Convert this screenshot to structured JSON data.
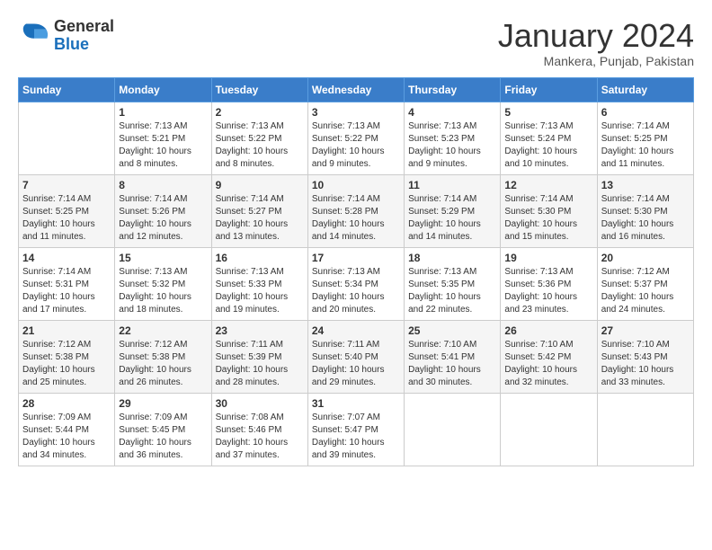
{
  "logo": {
    "general": "General",
    "blue": "Blue"
  },
  "title": "January 2024",
  "location": "Mankera, Punjab, Pakistan",
  "days_of_week": [
    "Sunday",
    "Monday",
    "Tuesday",
    "Wednesday",
    "Thursday",
    "Friday",
    "Saturday"
  ],
  "weeks": [
    [
      {
        "day": "",
        "info": ""
      },
      {
        "day": "1",
        "info": "Sunrise: 7:13 AM\nSunset: 5:21 PM\nDaylight: 10 hours\nand 8 minutes."
      },
      {
        "day": "2",
        "info": "Sunrise: 7:13 AM\nSunset: 5:22 PM\nDaylight: 10 hours\nand 8 minutes."
      },
      {
        "day": "3",
        "info": "Sunrise: 7:13 AM\nSunset: 5:22 PM\nDaylight: 10 hours\nand 9 minutes."
      },
      {
        "day": "4",
        "info": "Sunrise: 7:13 AM\nSunset: 5:23 PM\nDaylight: 10 hours\nand 9 minutes."
      },
      {
        "day": "5",
        "info": "Sunrise: 7:13 AM\nSunset: 5:24 PM\nDaylight: 10 hours\nand 10 minutes."
      },
      {
        "day": "6",
        "info": "Sunrise: 7:14 AM\nSunset: 5:25 PM\nDaylight: 10 hours\nand 11 minutes."
      }
    ],
    [
      {
        "day": "7",
        "info": "Sunrise: 7:14 AM\nSunset: 5:25 PM\nDaylight: 10 hours\nand 11 minutes."
      },
      {
        "day": "8",
        "info": "Sunrise: 7:14 AM\nSunset: 5:26 PM\nDaylight: 10 hours\nand 12 minutes."
      },
      {
        "day": "9",
        "info": "Sunrise: 7:14 AM\nSunset: 5:27 PM\nDaylight: 10 hours\nand 13 minutes."
      },
      {
        "day": "10",
        "info": "Sunrise: 7:14 AM\nSunset: 5:28 PM\nDaylight: 10 hours\nand 14 minutes."
      },
      {
        "day": "11",
        "info": "Sunrise: 7:14 AM\nSunset: 5:29 PM\nDaylight: 10 hours\nand 14 minutes."
      },
      {
        "day": "12",
        "info": "Sunrise: 7:14 AM\nSunset: 5:30 PM\nDaylight: 10 hours\nand 15 minutes."
      },
      {
        "day": "13",
        "info": "Sunrise: 7:14 AM\nSunset: 5:30 PM\nDaylight: 10 hours\nand 16 minutes."
      }
    ],
    [
      {
        "day": "14",
        "info": "Sunrise: 7:14 AM\nSunset: 5:31 PM\nDaylight: 10 hours\nand 17 minutes."
      },
      {
        "day": "15",
        "info": "Sunrise: 7:13 AM\nSunset: 5:32 PM\nDaylight: 10 hours\nand 18 minutes."
      },
      {
        "day": "16",
        "info": "Sunrise: 7:13 AM\nSunset: 5:33 PM\nDaylight: 10 hours\nand 19 minutes."
      },
      {
        "day": "17",
        "info": "Sunrise: 7:13 AM\nSunset: 5:34 PM\nDaylight: 10 hours\nand 20 minutes."
      },
      {
        "day": "18",
        "info": "Sunrise: 7:13 AM\nSunset: 5:35 PM\nDaylight: 10 hours\nand 22 minutes."
      },
      {
        "day": "19",
        "info": "Sunrise: 7:13 AM\nSunset: 5:36 PM\nDaylight: 10 hours\nand 23 minutes."
      },
      {
        "day": "20",
        "info": "Sunrise: 7:12 AM\nSunset: 5:37 PM\nDaylight: 10 hours\nand 24 minutes."
      }
    ],
    [
      {
        "day": "21",
        "info": "Sunrise: 7:12 AM\nSunset: 5:38 PM\nDaylight: 10 hours\nand 25 minutes."
      },
      {
        "day": "22",
        "info": "Sunrise: 7:12 AM\nSunset: 5:38 PM\nDaylight: 10 hours\nand 26 minutes."
      },
      {
        "day": "23",
        "info": "Sunrise: 7:11 AM\nSunset: 5:39 PM\nDaylight: 10 hours\nand 28 minutes."
      },
      {
        "day": "24",
        "info": "Sunrise: 7:11 AM\nSunset: 5:40 PM\nDaylight: 10 hours\nand 29 minutes."
      },
      {
        "day": "25",
        "info": "Sunrise: 7:10 AM\nSunset: 5:41 PM\nDaylight: 10 hours\nand 30 minutes."
      },
      {
        "day": "26",
        "info": "Sunrise: 7:10 AM\nSunset: 5:42 PM\nDaylight: 10 hours\nand 32 minutes."
      },
      {
        "day": "27",
        "info": "Sunrise: 7:10 AM\nSunset: 5:43 PM\nDaylight: 10 hours\nand 33 minutes."
      }
    ],
    [
      {
        "day": "28",
        "info": "Sunrise: 7:09 AM\nSunset: 5:44 PM\nDaylight: 10 hours\nand 34 minutes."
      },
      {
        "day": "29",
        "info": "Sunrise: 7:09 AM\nSunset: 5:45 PM\nDaylight: 10 hours\nand 36 minutes."
      },
      {
        "day": "30",
        "info": "Sunrise: 7:08 AM\nSunset: 5:46 PM\nDaylight: 10 hours\nand 37 minutes."
      },
      {
        "day": "31",
        "info": "Sunrise: 7:07 AM\nSunset: 5:47 PM\nDaylight: 10 hours\nand 39 minutes."
      },
      {
        "day": "",
        "info": ""
      },
      {
        "day": "",
        "info": ""
      },
      {
        "day": "",
        "info": ""
      }
    ]
  ]
}
